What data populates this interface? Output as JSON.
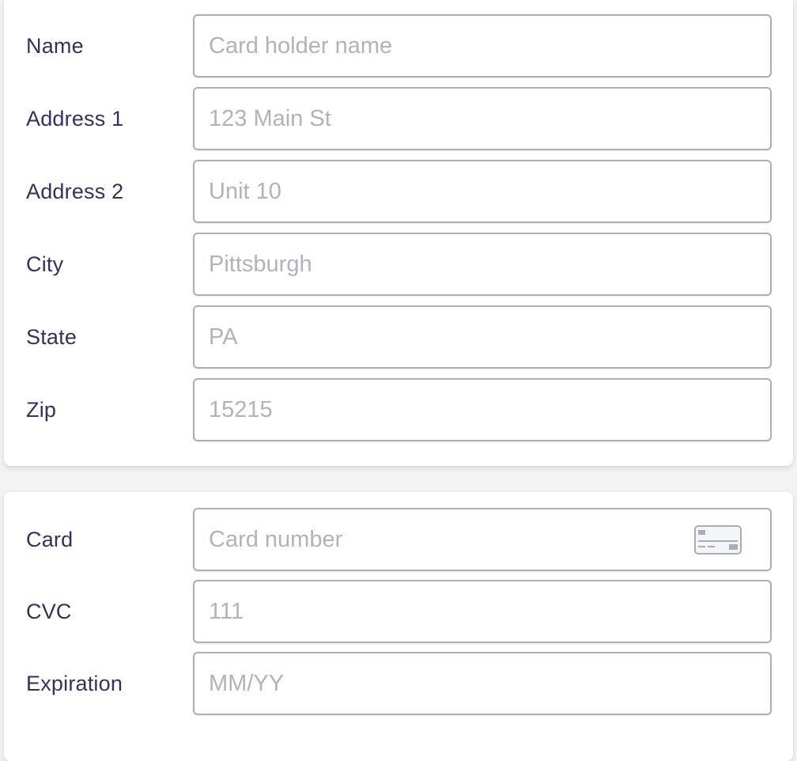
{
  "address_form": {
    "fields": [
      {
        "label": "Name",
        "placeholder": "Card holder name",
        "value": ""
      },
      {
        "label": "Address 1",
        "placeholder": "123 Main St",
        "value": ""
      },
      {
        "label": "Address 2",
        "placeholder": "Unit 10",
        "value": ""
      },
      {
        "label": "City",
        "placeholder": "Pittsburgh",
        "value": ""
      },
      {
        "label": "State",
        "placeholder": "PA",
        "value": ""
      },
      {
        "label": "Zip",
        "placeholder": "15215",
        "value": ""
      }
    ]
  },
  "card_form": {
    "fields": [
      {
        "label": "Card",
        "placeholder": "Card number",
        "value": "",
        "icon": "credit-card-icon"
      },
      {
        "label": "CVC",
        "placeholder": "111",
        "value": ""
      },
      {
        "label": "Expiration",
        "placeholder": "MM/YY",
        "value": ""
      }
    ]
  },
  "colors": {
    "label_text": "#32325d",
    "placeholder_text": "#b0b3b9",
    "field_border": "#aab0b8",
    "panel_background": "#ffffff",
    "page_background": "#f3f3f5"
  }
}
